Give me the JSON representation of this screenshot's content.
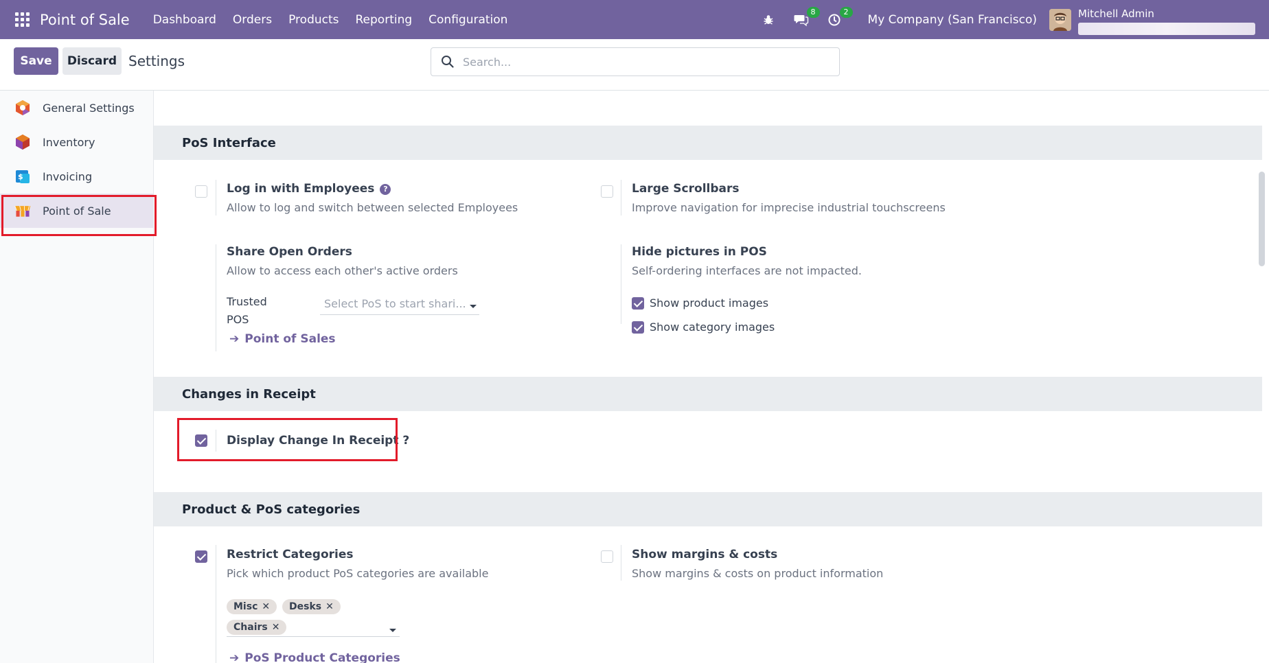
{
  "navbar": {
    "app_title": "Point of Sale",
    "menu": [
      "Dashboard",
      "Orders",
      "Products",
      "Reporting",
      "Configuration"
    ],
    "chat_badge": "8",
    "activity_badge": "2",
    "company": "My Company (San Francisco)",
    "user_name": "Mitchell Admin"
  },
  "control": {
    "save_label": "Save",
    "discard_label": "Discard",
    "title": "Settings",
    "search_placeholder": "Search..."
  },
  "sidebar": {
    "items": [
      {
        "label": "General Settings",
        "icon": "general-settings-icon"
      },
      {
        "label": "Inventory",
        "icon": "inventory-icon"
      },
      {
        "label": "Invoicing",
        "icon": "invoicing-icon"
      },
      {
        "label": "Point of Sale",
        "icon": "pos-icon",
        "active": true
      }
    ]
  },
  "sections": {
    "pos_interface": {
      "title": "PoS Interface",
      "login_employees": {
        "title": "Log in with Employees",
        "desc": "Allow to log and switch between selected Employees",
        "checked": false
      },
      "large_scrollbars": {
        "title": "Large Scrollbars",
        "desc": "Improve navigation for imprecise industrial touchscreens",
        "checked": false
      },
      "share_orders": {
        "title": "Share Open Orders",
        "desc": "Allow to access each other's active orders",
        "trusted_label_1": "Trusted",
        "trusted_label_2": "POS",
        "trusted_placeholder": "Select PoS to start shari...",
        "link": "Point of Sales"
      },
      "hide_pictures": {
        "title": "Hide pictures in POS",
        "desc": "Self-ordering interfaces are not impacted.",
        "opt_product": "Show product images",
        "opt_category": "Show category images"
      }
    },
    "receipt": {
      "title": "Changes in Receipt",
      "display_change": {
        "title": "Display Change In Receipt ?",
        "checked": true
      }
    },
    "categories": {
      "title": "Product & PoS categories",
      "restrict": {
        "title": "Restrict Categories",
        "desc": "Pick which product PoS categories are available",
        "checked": true,
        "tags": [
          "Misc",
          "Desks",
          "Chairs"
        ],
        "link": "PoS Product Categories"
      },
      "margins": {
        "title": "Show margins & costs",
        "desc": "Show margins & costs on product information",
        "checked": false
      }
    }
  },
  "colors": {
    "primary": "#71639e",
    "highlight": "#e21b2a"
  }
}
